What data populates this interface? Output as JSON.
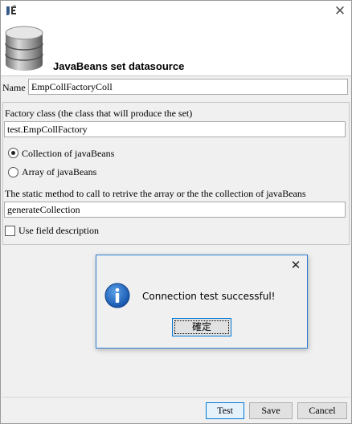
{
  "window": {
    "icon": "jasper-app-icon",
    "close_glyph": "✕",
    "header_icon": "database-icon",
    "title": "JavaBeans set datasource"
  },
  "form": {
    "name_label": "Name",
    "name_value": "EmpCollFactoryColl",
    "factory_label": "Factory class (the class that will produce the set)",
    "factory_value": "test.EmpCollFactory",
    "radio_collection_label": "Collection of javaBeans",
    "radio_collection_selected": true,
    "radio_array_label": "Array of javaBeans",
    "radio_array_selected": false,
    "method_label": "The static method to call to retrive the array or the the collection of javaBeans",
    "method_value": "generateCollection",
    "field_desc_label": "Use field description",
    "field_desc_checked": false
  },
  "buttons": {
    "test": "Test",
    "save": "Save",
    "cancel": "Cancel"
  },
  "dialog": {
    "close_glyph": "✕",
    "icon": "info-icon",
    "message": "Connection test successful!",
    "ok_label": "確定"
  },
  "colors": {
    "accent": "#0078d7",
    "info_blue": "#1565c0"
  }
}
